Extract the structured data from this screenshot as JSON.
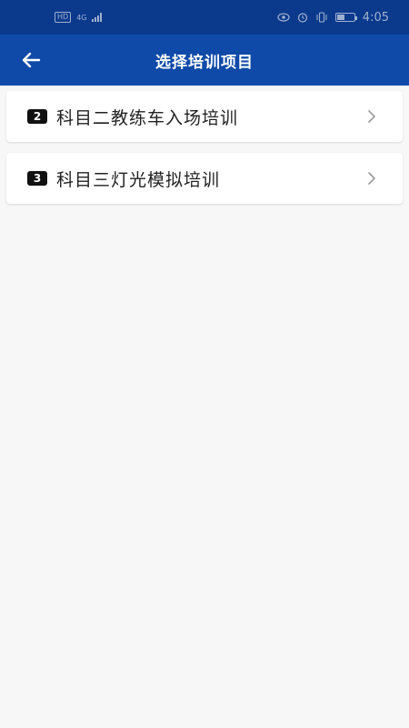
{
  "status_bar": {
    "network_badge": "HD",
    "signal_label": "4G",
    "time": "4:05",
    "battery_level": 0.4
  },
  "app_bar": {
    "title": "选择培训项目",
    "back_icon": "arrow-left-icon"
  },
  "items": [
    {
      "badge": "2",
      "label": "科目二教练车入场培训",
      "icon": "chevron-right-icon"
    },
    {
      "badge": "3",
      "label": "科目三灯光模拟培训",
      "icon": "chevron-right-icon"
    }
  ],
  "colors": {
    "status_bar_bg": "#0b3a8c",
    "app_bar_bg": "#0f4aa8",
    "page_bg": "#f7f7f7",
    "card_bg": "#ffffff",
    "badge_bg": "#111111"
  }
}
